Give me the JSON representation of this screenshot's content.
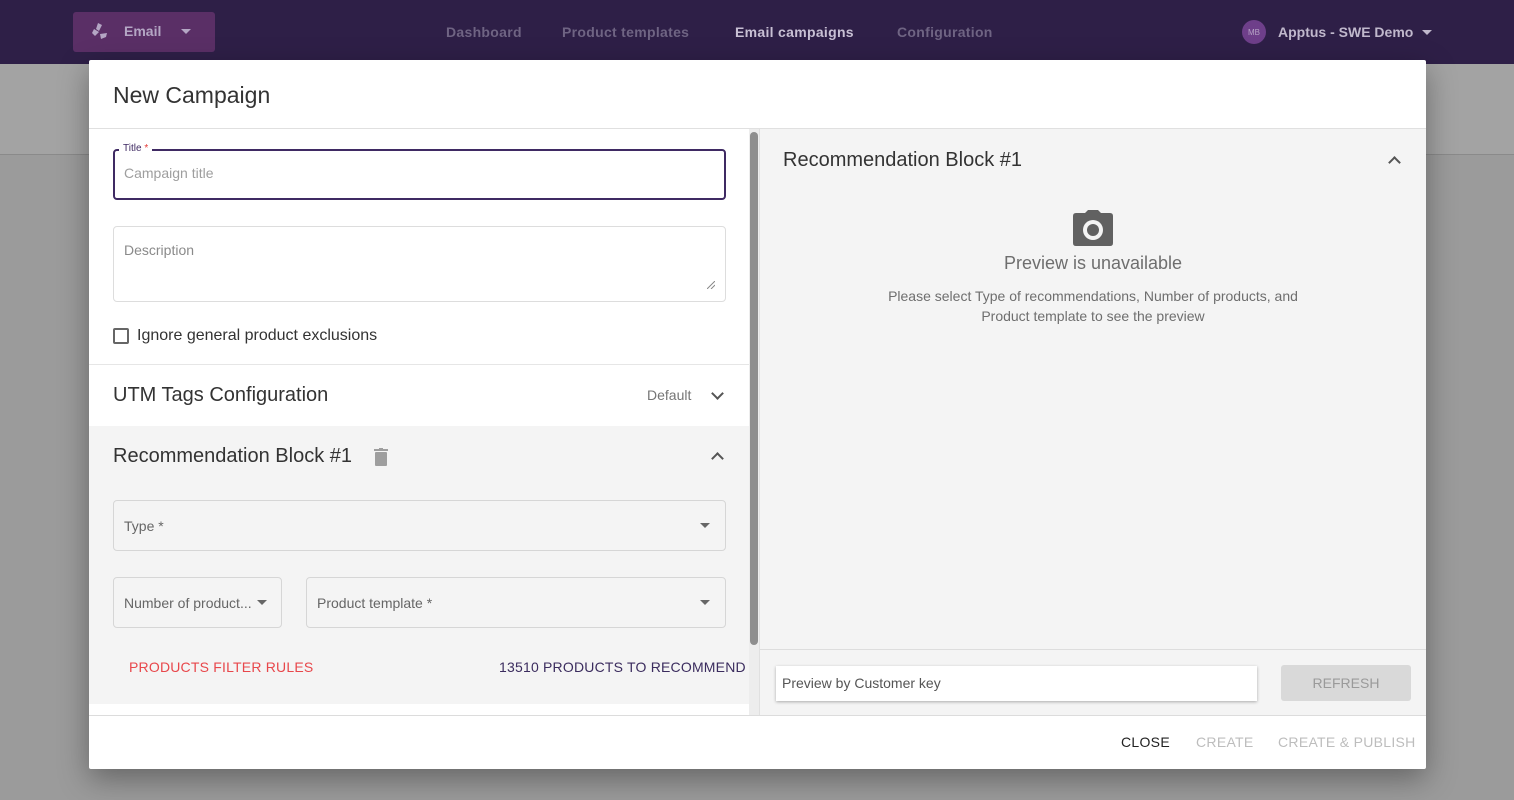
{
  "appbar": {
    "app_switcher_label": "Email",
    "nav": [
      {
        "label": "Dashboard",
        "active": false
      },
      {
        "label": "Product templates",
        "active": false
      },
      {
        "label": "Email campaigns",
        "active": true
      },
      {
        "label": "Configuration",
        "active": false
      }
    ],
    "account": {
      "initials": "MB",
      "name": "Apptus - SWE Demo"
    }
  },
  "modal": {
    "title": "New Campaign",
    "form": {
      "title_field": {
        "label": "Title",
        "required_mark": "*",
        "placeholder": "Campaign title",
        "value": ""
      },
      "description_field": {
        "placeholder": "Description",
        "value": ""
      },
      "ignore_exclusions": {
        "label": "Ignore general product exclusions",
        "checked": false
      },
      "utm": {
        "title": "UTM Tags Configuration",
        "value": "Default",
        "expanded": false
      },
      "recommendation_block": {
        "title": "Recommendation Block #1",
        "expanded": true,
        "type_select": {
          "placeholder": "Type *",
          "value": ""
        },
        "number_select": {
          "placeholder": "Number of product...",
          "value": ""
        },
        "template_select": {
          "placeholder": "Product template *",
          "value": ""
        },
        "filter_rules_link": "PRODUCTS FILTER RULES",
        "recommend_count": "13510 PRODUCTS TO RECOMMEND"
      }
    },
    "preview": {
      "title": "Recommendation Block #1",
      "expanded": true,
      "icon": "camera-icon",
      "heading": "Preview is unavailable",
      "hint": "Please select Type of recommendations, Number of products, and Product template to see the preview",
      "customer_key": {
        "placeholder": "Preview by Customer key",
        "value": ""
      },
      "refresh_label": "REFRESH"
    },
    "footer": {
      "close_label": "CLOSE",
      "create_label": "CREATE",
      "create_publish_label": "CREATE & PUBLISH"
    }
  },
  "colors": {
    "appbar_bg": "#2e1f47",
    "primary": "#3f2a63",
    "app_switch_bg": "#5a2f66",
    "danger_link": "#e8474b"
  }
}
